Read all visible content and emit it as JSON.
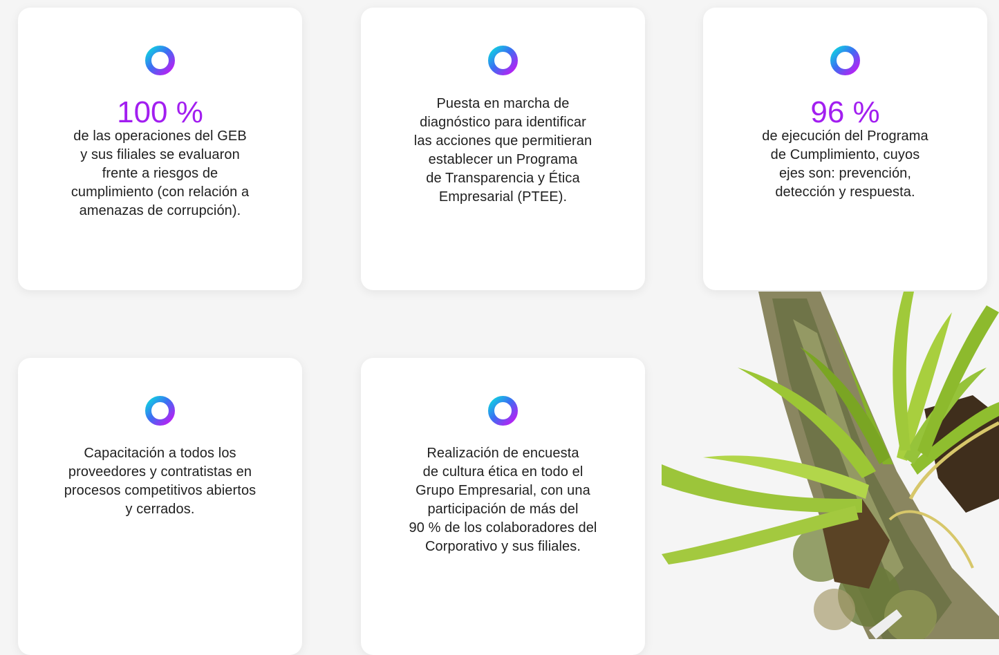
{
  "colors": {
    "background": "#f5f5f5",
    "card": "#ffffff",
    "stat_purple": "#a21ef0",
    "ring_cyan": "#19c7e6",
    "ring_blue": "#3d7bf2",
    "ring_purple": "#b61ef5"
  },
  "cards": [
    {
      "icon": "gradient-ring-icon",
      "stat": "100 %",
      "text": "de las operaciones del GEB\ny sus filiales se evaluaron\nfrente a riesgos de\ncumplimiento (con relación a\namenazas de corrupción)."
    },
    {
      "icon": "gradient-ring-icon",
      "text": "Puesta en marcha de\ndiagnóstico para identificar\nlas acciones que permitieran\nestablecer un Programa\nde Transparencia y Ética\nEmpresarial (PTEE)."
    },
    {
      "icon": "gradient-ring-icon",
      "stat": "96 %",
      "text": "de ejecución del Programa\nde Cumplimiento, cuyos\nejes son: prevención,\ndetección y respuesta."
    },
    {
      "icon": "gradient-ring-icon",
      "text": "Capacitación a todos los\nproveedores y contratistas en\nprocesos competitivos abiertos\ny cerrados."
    },
    {
      "icon": "gradient-ring-icon",
      "text": "Realización de encuesta\nde cultura ética en todo el\nGrupo Empresarial, con una\nparticipación de más del\n90 % de los colaboradores del\nCorporativo y sus filiales."
    }
  ],
  "image": {
    "subject": "bromeliad-plant-on-branch"
  }
}
